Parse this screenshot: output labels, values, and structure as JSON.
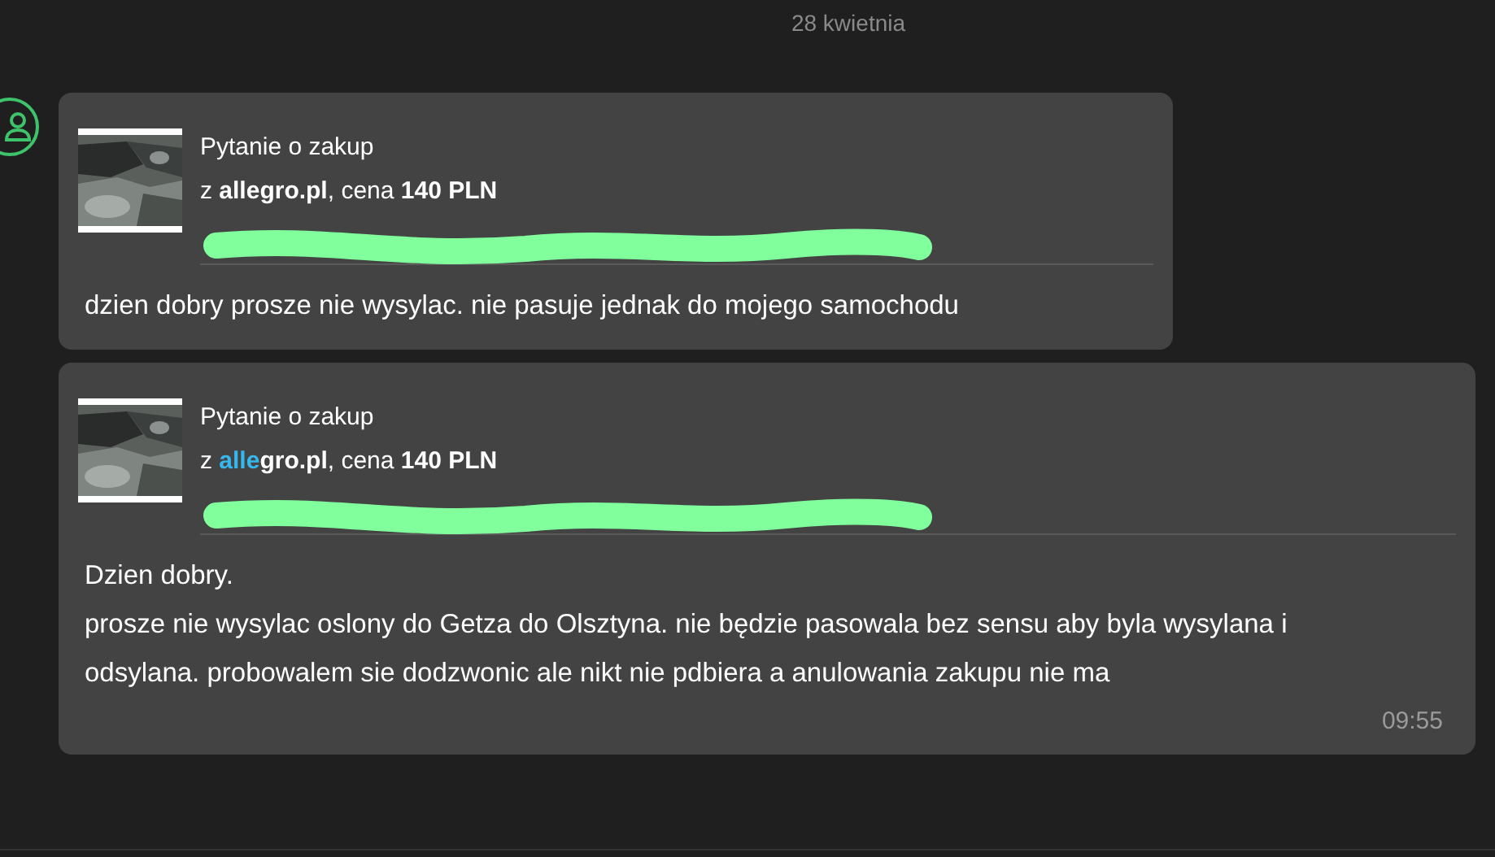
{
  "date_separator": "28 kwietnia",
  "messages": [
    {
      "card": {
        "kind": "picture",
        "title": "Pytanie o zakup",
        "source_prefix": "z ",
        "source": [
          {
            "text": "allegro.pl",
            "highlighted": false
          }
        ],
        "price_prefix": ", cena ",
        "price": "140 PLN",
        "link_redacted": true
      },
      "text": "dzien dobry prosze nie wysylac. nie pasuje jednak do mojego samochodu"
    },
    {
      "card": {
        "kind": "picture",
        "title": "Pytanie o zakup",
        "source_prefix": "z ",
        "source": [
          {
            "text": "alle",
            "highlighted": true
          },
          {
            "text": "gro.pl",
            "highlighted": false
          }
        ],
        "price_prefix": ", cena ",
        "price": "140 PLN",
        "link_redacted": true
      },
      "text": "Dzien dobry.\nprosze nie wysylac oslony do Getza do Olsztyna. nie będzie pasowala bez sensu aby byla wysylana i odsylana. probowalem sie dodzwonic ale nikt nie pdbiera a anulowania zakupu nie ma",
      "time": "09:55"
    }
  ]
}
